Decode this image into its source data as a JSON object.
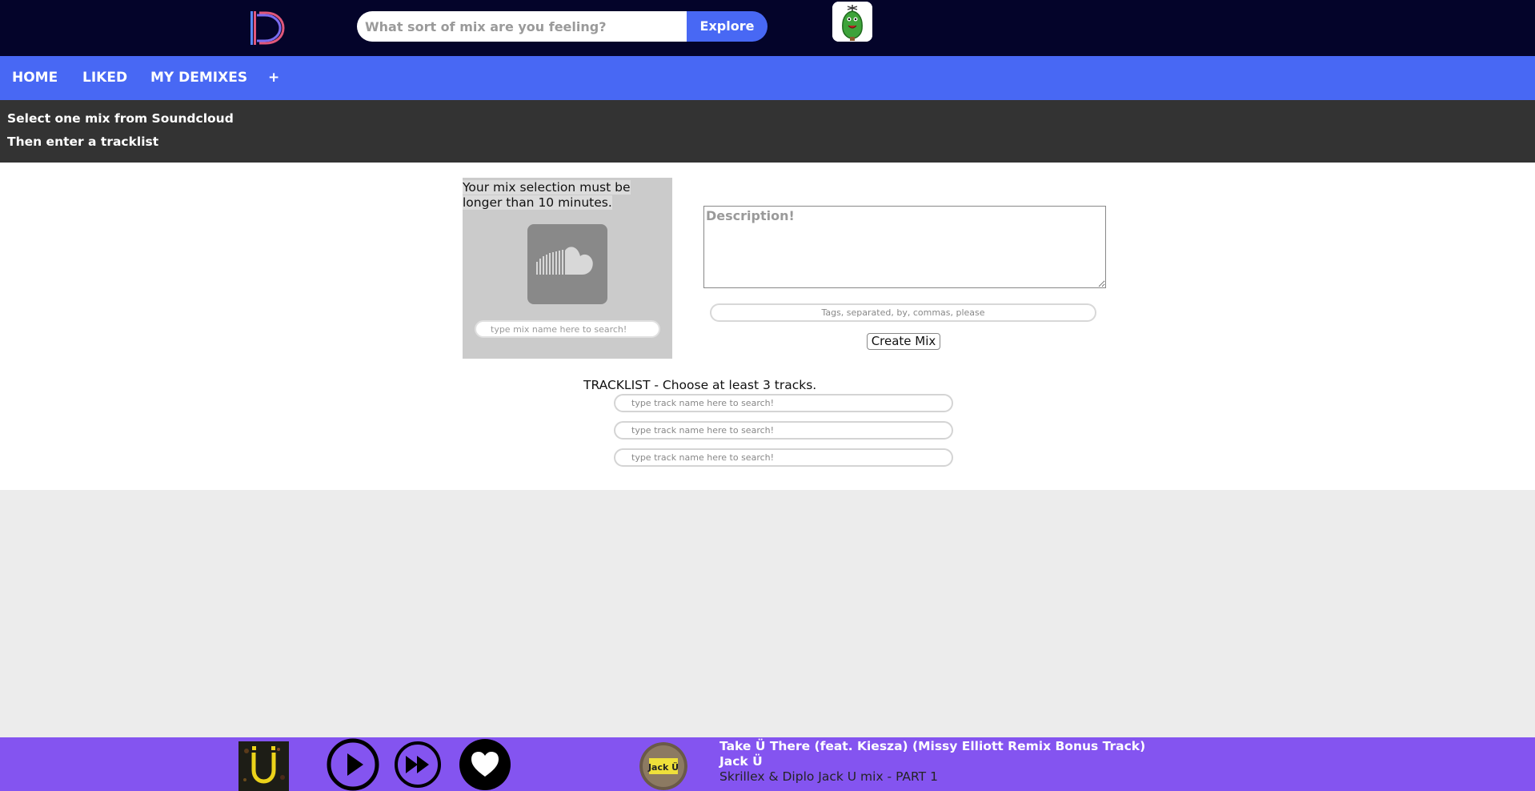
{
  "header": {
    "logo_icon": "demix-d-logo",
    "search": {
      "placeholder": "What sort of mix are you feeling?",
      "value": ""
    },
    "explore_label": "Explore",
    "avatar_icon": "green-creature-avatar"
  },
  "nav": {
    "items": [
      {
        "label": "HOME"
      },
      {
        "label": "LIKED"
      },
      {
        "label": "MY DEMIXES"
      },
      {
        "label": "+"
      }
    ]
  },
  "instructions": {
    "line1": "Select one mix from Soundcloud",
    "line2": "Then enter a tracklist"
  },
  "mix_select": {
    "note_line1": "Your mix selection must be",
    "note_line2": "longer than 10 minutes.",
    "icon": "soundcloud-icon",
    "search_placeholder": "type mix name here to search!"
  },
  "form": {
    "description_placeholder": "Description!",
    "tags_placeholder": "Tags, separated, by, commas, please",
    "create_label": "Create Mix"
  },
  "tracklist": {
    "title": "TRACKLIST - Choose at least 3 tracks.",
    "inputs": [
      {
        "placeholder": "type track name here to search!"
      },
      {
        "placeholder": "type track name here to search!"
      },
      {
        "placeholder": "type track name here to search!"
      }
    ]
  },
  "player": {
    "now_playing_title": "Take Ü There (feat. Kiesza) (Missy Elliott Remix Bonus Track)",
    "artist": "Jack Ü",
    "mix_name": "Skrillex & Diplo Jack U mix - PART 1",
    "controls": [
      "play-icon",
      "fast-forward-icon",
      "heart-icon"
    ]
  },
  "colors": {
    "topbar": "#04042a",
    "accent_blue": "#4868f4",
    "instructions_bg": "#333333",
    "player_bg": "#8454f0",
    "mix_name_color": "#242424"
  }
}
